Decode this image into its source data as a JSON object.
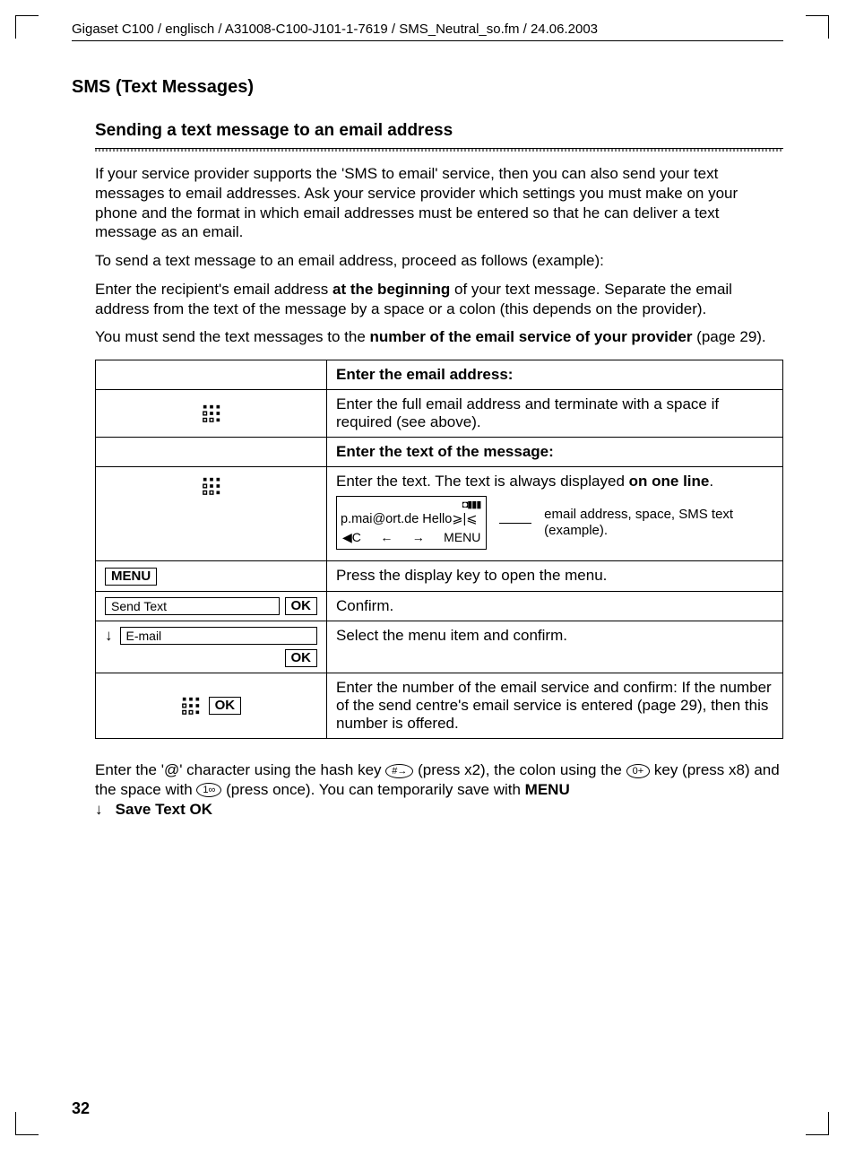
{
  "runhead": "Gigaset C100 / englisch / A31008-C100-J101-1-7619 / SMS_Neutral_so.fm / 24.06.2003",
  "section_title": "SMS (Text Messages)",
  "sub_title": "Sending a text message to an email address",
  "p1": "If your service provider supports the 'SMS to email' service, then you can also send your text messages to email addresses. Ask your service provider which settings you must make on your phone and the format in which email addresses must be entered so that he can deliver a text message as an email.",
  "p2": "To send a text message to an email address, proceed as follows (example):",
  "p3a": "Enter the recipient's email address ",
  "p3b": "at the beginning",
  "p3c": " of your text message. Separate the email address from the text of the message by a space or a colon (this depends on the provider).",
  "p4a": "You must send the text messages to the ",
  "p4b": "number of the email service of your provider",
  "p4c": " (page 29).",
  "table": {
    "r1": {
      "right": "Enter the email address:"
    },
    "r2": {
      "right": "Enter the full email address and terminate with a space if required (see above)."
    },
    "r3": {
      "right": "Enter the text of the message:"
    },
    "r4": {
      "right_top_a": "Enter the text. The text is always displayed ",
      "right_top_b": "on one line",
      "right_top_c": ".",
      "lcd_top": "◘▮▮▮",
      "lcd_mid": "p.mai@ort.de Hello⩾|⩽",
      "lcd_c": "◀C",
      "lcd_left": "←",
      "lcd_right": "→",
      "lcd_menu": "MENU",
      "note": "email address, space, SMS text (example)."
    },
    "r5": {
      "left": "MENU",
      "right": "Press the display key to open the menu."
    },
    "r6": {
      "left_item": "Send Text",
      "left_ok": "OK",
      "right": "Confirm."
    },
    "r7": {
      "arrow": "↓",
      "left_item": "E-mail",
      "left_ok": "OK",
      "right": "Select the menu item and confirm."
    },
    "r8": {
      "left_ok": "OK",
      "right": "Enter the number of the email service and confirm: If the number of the send centre's email service is entered (page 29), then this number is offered."
    }
  },
  "foot": {
    "a": "Enter the '@' character using the hash key ",
    "key_hash": "#→",
    "b": " (press x2), the colon using the ",
    "key_zero": "0+",
    "c": " key (press x8) and the space with ",
    "key_one": "1∞",
    "d": " (press once). You can temporarily save with ",
    "menu": "MENU",
    "arrow": "↓",
    "save": "Save Text OK"
  },
  "page_number": "32"
}
